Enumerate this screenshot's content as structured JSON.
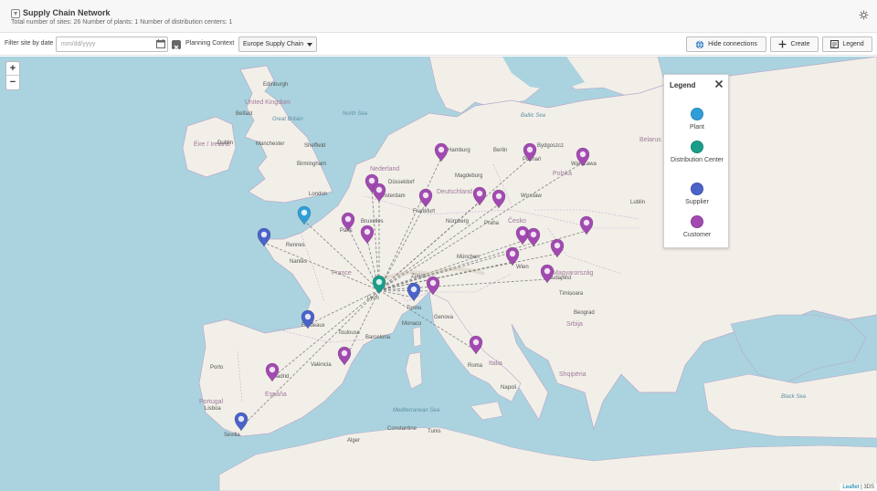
{
  "header": {
    "title": "Supply Chain Network",
    "subtitle": "Total number of sites: 26 Number of plants: 1 Number of distribution centers: 1"
  },
  "toolbar": {
    "filter_label": "Filter site by date",
    "date_placeholder": "mm/dd/yyyy",
    "planning_label": "Planning Context",
    "planning_value": "Europe Supply Chain",
    "hide_connections": "Hide connections",
    "create": "Create",
    "legend": "Legend"
  },
  "zoom": {
    "in": "+",
    "out": "−"
  },
  "legend": {
    "title": "Legend",
    "items": [
      {
        "label": "Plant",
        "color": "#2f9ed8"
      },
      {
        "label": "Distribution Center",
        "color": "#1a9e8a"
      },
      {
        "label": "Supplier",
        "color": "#4a62c9"
      },
      {
        "label": "Customer",
        "color": "#a24ab1"
      }
    ]
  },
  "attribution": {
    "leaflet": "Leaflet",
    "rest": "| 3DS"
  },
  "colors": {
    "plant": "#2f9ed8",
    "dc": "#1a9e8a",
    "supplier": "#4a62c9",
    "customer": "#a24ab1",
    "sea": "#aad3df",
    "land": "#f2efe9"
  },
  "labels": {
    "countries": [
      "United Kingdom",
      "Éire / Ireland",
      "Nederland",
      "Deutschland",
      "France",
      "España",
      "Portugal",
      "Polska",
      "Česko",
      "Magyarország",
      "Italia",
      "Srbija",
      "Shqipëria",
      "Belarus"
    ],
    "cities": [
      "Edinburgh",
      "Belfast",
      "Dublin",
      "Manchester",
      "Birmingham",
      "London",
      "Sheffield",
      "Paris",
      "Rennes",
      "Nantes",
      "Lyon",
      "Bordeaux",
      "Toulouse",
      "Monaco",
      "Madrid",
      "Sevilla",
      "València",
      "Barcelona",
      "Lisboa",
      "Porto",
      "Bruxelles",
      "Amsterdam",
      "Düsseldorf",
      "Hamburg",
      "Berlin",
      "Magdeburg",
      "Frankfurt",
      "Nürnberg",
      "München",
      "Zürich",
      "Torino",
      "Genova",
      "Roma",
      "Napoli",
      "Warszawa",
      "Poznań",
      "Wrocław",
      "Praha",
      "Wien",
      "Budapest",
      "Beograd",
      "Bydgoszcz",
      "Lublin",
      "Timișoara",
      "Constantine",
      "Alger",
      "Tunis"
    ],
    "seas": [
      "Great Britain",
      "North Sea",
      "Baltic Sea",
      "Mediterranean Sea",
      "Black Sea"
    ]
  }
}
